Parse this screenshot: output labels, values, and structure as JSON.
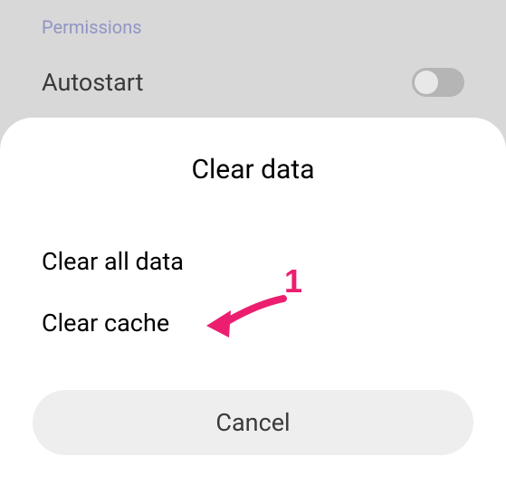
{
  "background": {
    "permissions_label": "Permissions",
    "autostart_label": "Autostart",
    "autostart_enabled": false
  },
  "modal": {
    "title": "Clear data",
    "options": {
      "clear_all": "Clear all data",
      "clear_cache": "Clear cache"
    },
    "cancel_label": "Cancel"
  },
  "annotation": {
    "number": "1",
    "color": "#ec1e70"
  }
}
